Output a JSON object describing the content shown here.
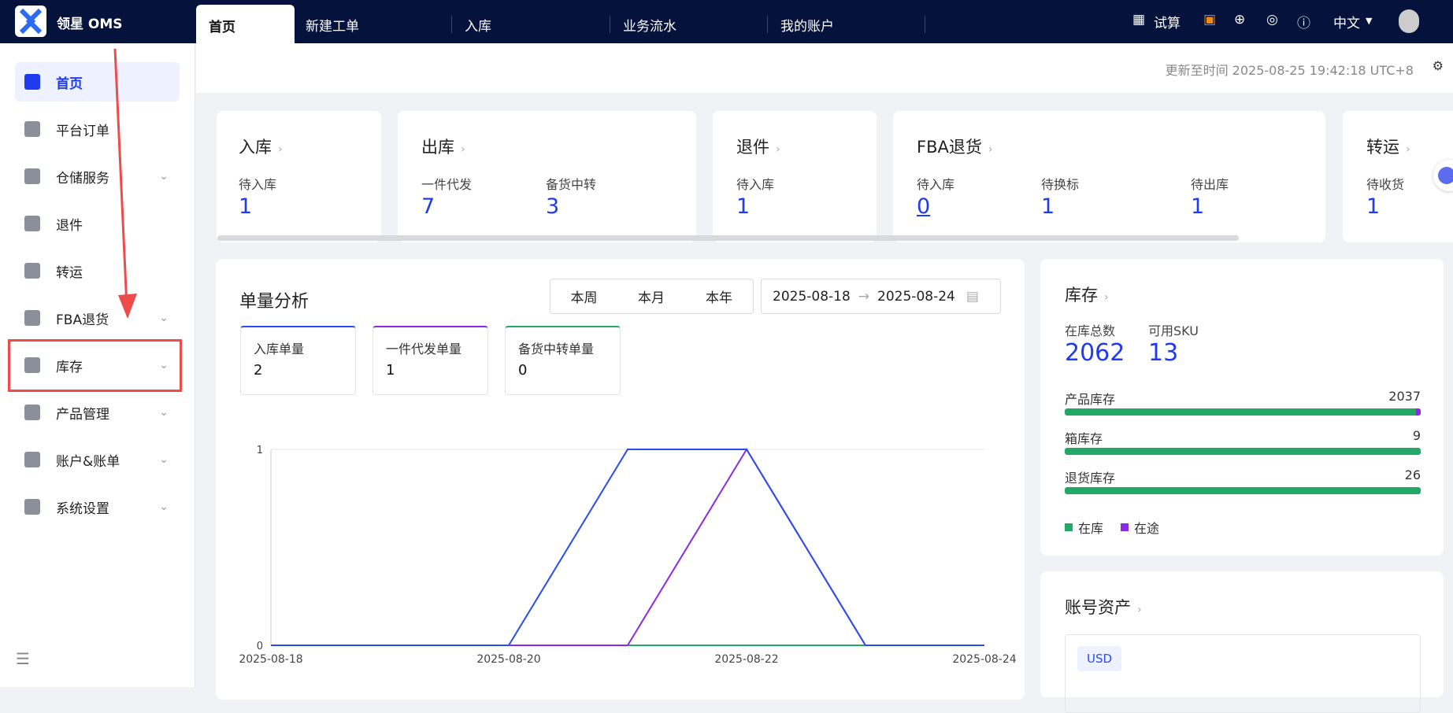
{
  "app": {
    "brand": "领星 OMS"
  },
  "nav_tabs": [
    "首页",
    "新建工单",
    "入库",
    "业务流水",
    "我的账户"
  ],
  "top_right": {
    "trial": "试算",
    "language": "中文"
  },
  "sidebar": {
    "items": [
      {
        "label": "首页",
        "active": true
      },
      {
        "label": "平台订单"
      },
      {
        "label": "仓储服务",
        "chevron": true
      },
      {
        "label": "退件"
      },
      {
        "label": "转运"
      },
      {
        "label": "FBA退货",
        "chevron": true
      },
      {
        "label": "库存",
        "chevron": true
      },
      {
        "label": "产品管理",
        "chevron": true
      },
      {
        "label": "账户&账单",
        "chevron": true
      },
      {
        "label": "系统设置",
        "chevron": true
      }
    ]
  },
  "update_time": "更新至时间 2025-08-25 19:42:18 UTC+8",
  "cards": [
    {
      "title": "入库",
      "items": [
        {
          "label": "待入库",
          "value": "1"
        }
      ]
    },
    {
      "title": "出库",
      "items": [
        {
          "label": "一件代发",
          "value": "7"
        },
        {
          "label": "备货中转",
          "value": "3"
        }
      ]
    },
    {
      "title": "退件",
      "items": [
        {
          "label": "待入库",
          "value": "1"
        }
      ]
    },
    {
      "title": "FBA退货",
      "items": [
        {
          "label": "待入库",
          "value": "0"
        },
        {
          "label": "待换标",
          "value": "1"
        },
        {
          "label": "待出库",
          "value": "1"
        }
      ]
    },
    {
      "title": "转运",
      "items": [
        {
          "label": "待收货",
          "value": "1"
        }
      ]
    }
  ],
  "analysis": {
    "title": "单量分析",
    "ranges": [
      "本周",
      "本月",
      "本年"
    ],
    "date_start": "2025-08-18",
    "date_end": "2025-08-24",
    "stats": [
      {
        "label": "入库单量",
        "value": "2",
        "color": "#2b4bf2"
      },
      {
        "label": "一件代发单量",
        "value": "1",
        "color": "#8a2be2"
      },
      {
        "label": "备货中转单量",
        "value": "0",
        "color": "#22a867"
      }
    ]
  },
  "chart_data": {
    "type": "line",
    "x": [
      "2025-08-18",
      "2025-08-19",
      "2025-08-20",
      "2025-08-21",
      "2025-08-22",
      "2025-08-23",
      "2025-08-24"
    ],
    "xticks": [
      "2025-08-18",
      "2025-08-20",
      "2025-08-22",
      "2025-08-24"
    ],
    "yticks": [
      "0",
      "1"
    ],
    "ylim": [
      0,
      1
    ],
    "series": [
      {
        "name": "入库单量",
        "color": "#2b4bf2",
        "values": [
          0,
          0,
          0,
          1,
          1,
          0,
          0
        ]
      },
      {
        "name": "一件代发单量",
        "color": "#8a2be2",
        "values": [
          0,
          0,
          0,
          0,
          1,
          0,
          0
        ]
      },
      {
        "name": "备货中转单量",
        "color": "#22a867",
        "values": [
          0,
          0,
          0,
          0,
          0,
          0,
          0
        ]
      }
    ]
  },
  "inventory": {
    "title": "库存",
    "total_label": "在库总数",
    "total": "2062",
    "sku_label": "可用SKU",
    "sku": "13",
    "bars": [
      {
        "label": "产品库存",
        "value": "2037",
        "in_transit_fraction": 0.004
      },
      {
        "label": "箱库存",
        "value": "9",
        "in_transit_fraction": 0
      },
      {
        "label": "退货库存",
        "value": "26",
        "in_transit_fraction": 0
      }
    ],
    "legend": [
      "在库",
      "在途"
    ]
  },
  "assets": {
    "title": "账号资产",
    "currency": "USD"
  }
}
